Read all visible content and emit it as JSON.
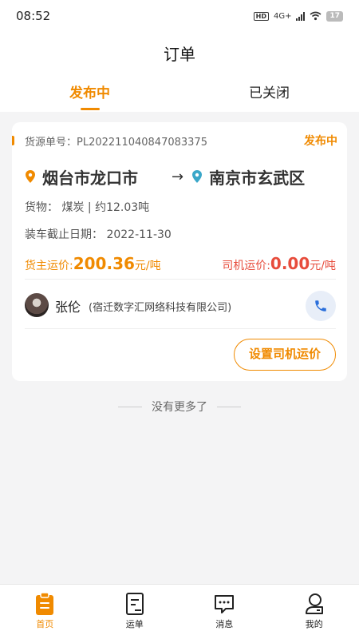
{
  "status_bar": {
    "time": "08:52",
    "hd": "HD",
    "network": "4G+",
    "battery": "17"
  },
  "header": {
    "title": "订单"
  },
  "tabs": [
    {
      "label": "发布中",
      "active": true
    },
    {
      "label": "已关闭",
      "active": false
    }
  ],
  "order": {
    "number_label": "货源单号：",
    "number": "PL202211040847083375",
    "status": "发布中",
    "origin": "烟台市龙口市",
    "destination": "南京市玄武区",
    "cargo": "货物：  煤炭 | 约12.03吨",
    "deadline": "装车截止日期：  2022-11-30",
    "owner_price_label": "货主运价:",
    "owner_price_value": "200.36",
    "owner_price_unit": "元/吨",
    "driver_price_label": "司机运价:",
    "driver_price_value": "0.00",
    "driver_price_unit": "元/吨",
    "contact_name": "张伦",
    "contact_company": "(宿迁数字汇网络科技有限公司)",
    "set_price_button": "设置司机运价"
  },
  "footer_note": "没有更多了",
  "nav": [
    {
      "label": "首页",
      "icon": "clipboard-icon",
      "active": true
    },
    {
      "label": "运单",
      "icon": "document-icon",
      "active": false
    },
    {
      "label": "消息",
      "icon": "message-icon",
      "active": false
    },
    {
      "label": "我的",
      "icon": "profile-icon",
      "active": false
    }
  ],
  "colors": {
    "accent": "#f08a00",
    "driver_price": "#e74c3c",
    "phone": "#2a6fdb",
    "destination_pin": "#3aa7c9"
  }
}
